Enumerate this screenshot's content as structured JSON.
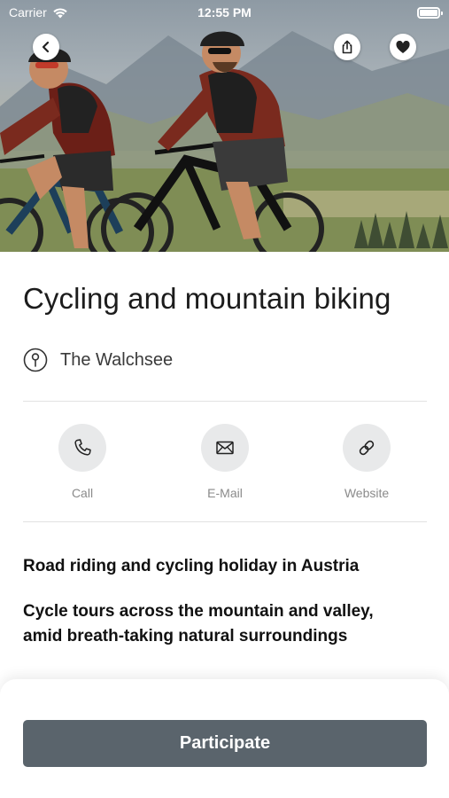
{
  "status_bar": {
    "carrier": "Carrier",
    "time": "12:55 PM"
  },
  "hero": {
    "image_description_icon": "cycling-photo"
  },
  "nav": {
    "back_icon": "chevron-left-icon",
    "share_icon": "share-icon",
    "favorite_icon": "heart-icon"
  },
  "event": {
    "title": "Cycling and mountain biking",
    "location": "The Walchsee",
    "subtitle": "Road riding and cycling holiday in Austria",
    "description": "Cycle tours across the mountain and valley, amid breath-taking natural surroundings"
  },
  "contacts": [
    {
      "label": "Call",
      "icon": "phone-icon"
    },
    {
      "label": "E-Mail",
      "icon": "mail-icon"
    },
    {
      "label": "Website",
      "icon": "link-icon"
    }
  ],
  "actions": {
    "participate_label": "Participate"
  },
  "colors": {
    "primary_button": "#5a646c",
    "contact_circle": "#e8e9ea",
    "label_gray": "#8a8a8a"
  }
}
